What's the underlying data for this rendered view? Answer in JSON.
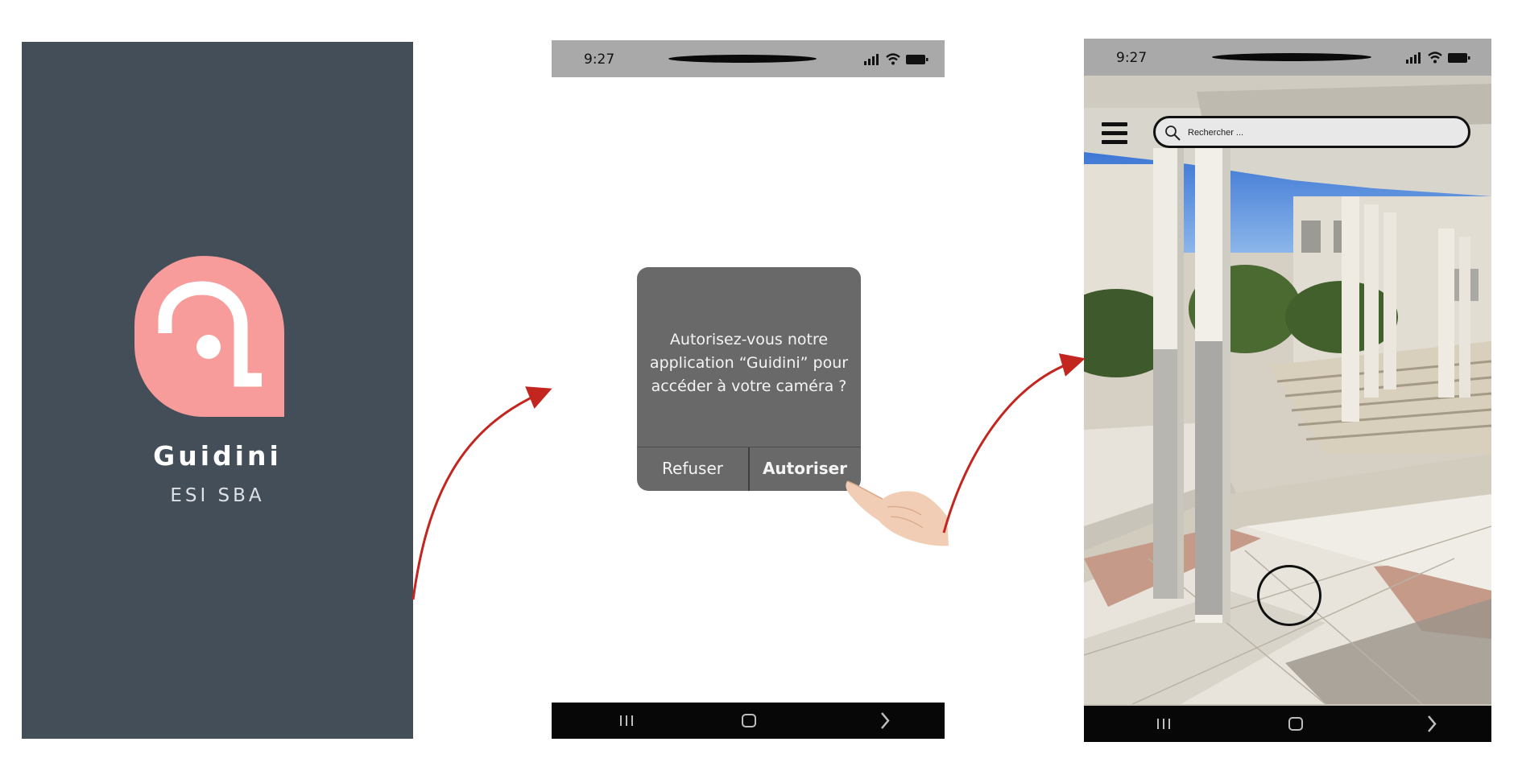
{
  "splash": {
    "app_name": "Guidini",
    "subtitle": "ESI SBA",
    "background_color": "#444e59",
    "logo_color": "#f79b9b",
    "logo_icon": "location-pin-logo"
  },
  "permission_screen": {
    "status_bar": {
      "time": "9:27",
      "icons": [
        "signal-icon",
        "wifi-icon",
        "battery-icon"
      ]
    },
    "dialog": {
      "message": "Autorisez-vous notre application “Guidini”  pour accéder à votre caméra ?",
      "deny_label": "Refuser",
      "allow_label": "Autoriser",
      "background_color": "#696969"
    },
    "pointer": "hand-pointer-icon",
    "nav_bar": {
      "icons": [
        "recent-apps-icon",
        "home-icon",
        "back-chevron-icon"
      ]
    }
  },
  "camera_screen": {
    "status_bar": {
      "time": "9:27",
      "icons": [
        "signal-icon",
        "wifi-icon",
        "battery-icon"
      ]
    },
    "menu_icon": "hamburger-menu-icon",
    "search": {
      "placeholder": "Rechercher ...",
      "icon": "search-icon"
    },
    "shutter_icon": "capture-circle-icon",
    "nav_bar": {
      "icons": [
        "recent-apps-icon",
        "home-icon",
        "back-chevron-icon"
      ]
    }
  },
  "flow": {
    "arrow_color": "#c3261f",
    "arrows": 2
  }
}
